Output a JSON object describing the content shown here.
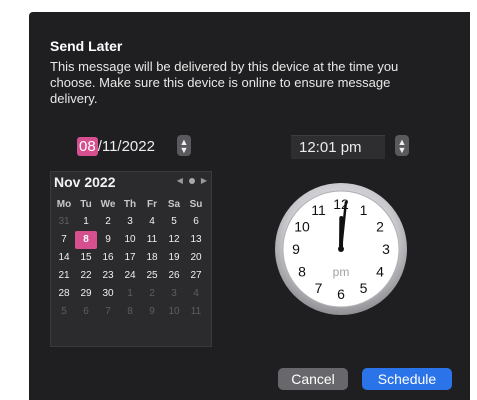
{
  "dialog": {
    "title": "Send Later",
    "message": "This message will be delivered by this device at the time you choose. Make sure this device is online to ensure message delivery."
  },
  "date": {
    "month": "08",
    "rest": "/11/2022"
  },
  "time": {
    "value": "12:01 pm"
  },
  "calendar": {
    "month_label": "Nov 2022",
    "weekdays": [
      "Mo",
      "Tu",
      "We",
      "Th",
      "Fr",
      "Sa",
      "Su"
    ],
    "weeks": [
      [
        "31",
        "1",
        "2",
        "3",
        "4",
        "5",
        "6"
      ],
      [
        "7",
        "8",
        "9",
        "10",
        "11",
        "12",
        "13"
      ],
      [
        "14",
        "15",
        "16",
        "17",
        "18",
        "19",
        "20"
      ],
      [
        "21",
        "22",
        "23",
        "24",
        "25",
        "26",
        "27"
      ],
      [
        "28",
        "29",
        "30",
        "1",
        "2",
        "3",
        "4"
      ],
      [
        "5",
        "6",
        "7",
        "8",
        "9",
        "10",
        "11"
      ]
    ],
    "dimmed": [
      [
        0,
        0
      ],
      [
        4,
        3
      ],
      [
        4,
        4
      ],
      [
        4,
        5
      ],
      [
        4,
        6
      ],
      [
        5,
        0
      ],
      [
        5,
        1
      ],
      [
        5,
        2
      ],
      [
        5,
        3
      ],
      [
        5,
        4
      ],
      [
        5,
        5
      ],
      [
        5,
        6
      ]
    ],
    "selected": [
      1,
      1
    ],
    "selected_color": "#d64f8f"
  },
  "clock": {
    "numbers": [
      "12",
      "1",
      "2",
      "3",
      "4",
      "5",
      "6",
      "7",
      "8",
      "9",
      "10",
      "11"
    ],
    "period": "pm",
    "hour": 12,
    "minute": 1
  },
  "buttons": {
    "cancel": "Cancel",
    "schedule": "Schedule"
  },
  "colors": {
    "accent_pink": "#d64f8f",
    "accent_blue": "#2a73e8",
    "dialog_bg": "#1f1f21"
  }
}
